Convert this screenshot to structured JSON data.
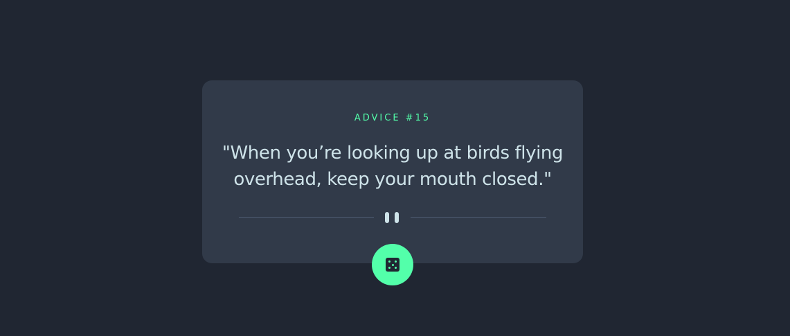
{
  "advice": {
    "id_label": "ADVICE #15",
    "quote": "\"When you’re looking up at birds flying overhead, keep your mouth closed.\""
  },
  "divider": {
    "icon": "pause-icon"
  },
  "button": {
    "icon": "dice-icon"
  },
  "colors": {
    "background": "#202632",
    "card": "#313a49",
    "accent": "#53ffaa",
    "text": "#cee3e9",
    "divider": "#4f5d74"
  }
}
